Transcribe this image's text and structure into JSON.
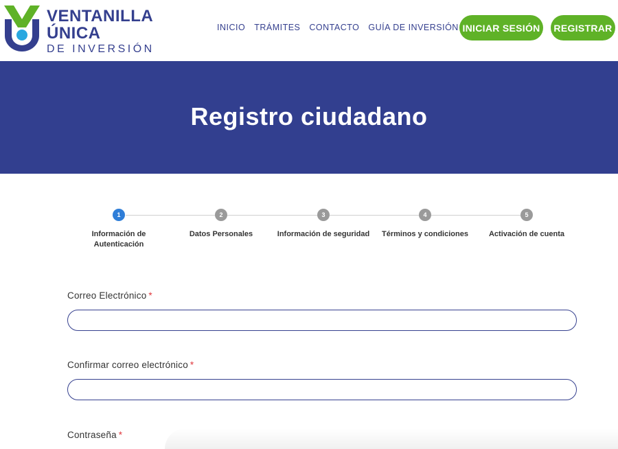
{
  "brand": {
    "line1": "VENTANILLA",
    "line2": "ÚNICA",
    "line3": "DE INVERSIÓN",
    "colors": {
      "primary": "#343f8e",
      "accent_green": "#5fb227",
      "accent_blue": "#29a8e0"
    }
  },
  "nav": [
    {
      "label": "INICIO"
    },
    {
      "label": "TRÁMITES"
    },
    {
      "label": "CONTACTO"
    },
    {
      "label": "GUÍA DE INVERSIÓN"
    }
  ],
  "actions": {
    "login": "INICIAR SESIÓN",
    "register": "REGISTRAR"
  },
  "page": {
    "title": "Registro ciudadano"
  },
  "stepper": {
    "active_step": 1,
    "steps": [
      {
        "number": "1",
        "label": "Información de Autenticación"
      },
      {
        "number": "2",
        "label": "Datos Personales"
      },
      {
        "number": "3",
        "label": "Información de seguridad"
      },
      {
        "number": "4",
        "label": "Términos y condiciones"
      },
      {
        "number": "5",
        "label": "Activación de cuenta"
      }
    ]
  },
  "form": {
    "required_marker": "*",
    "fields": [
      {
        "label": "Correo Electrónico",
        "value": "",
        "placeholder": ""
      },
      {
        "label": "Confirmar correo electrónico",
        "value": "",
        "placeholder": ""
      },
      {
        "label": "Contraseña",
        "value": "",
        "placeholder": ""
      }
    ]
  }
}
